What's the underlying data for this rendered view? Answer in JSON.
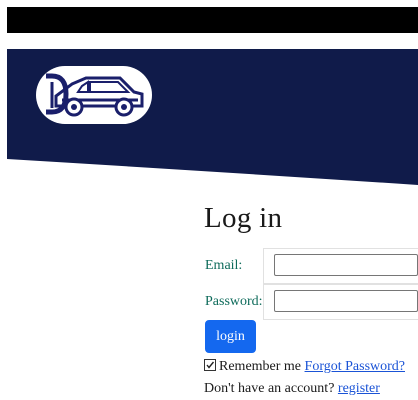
{
  "colors": {
    "hero_background": "#101b4a",
    "label_text": "#0e6b5b",
    "login_button": "#1468ef",
    "link": "#1a53d6"
  },
  "header": {
    "logo_icon": "van-logo-icon"
  },
  "login": {
    "title": "Log in",
    "email_label": "Email:",
    "email_value": "",
    "password_label": "Password:",
    "password_value": "",
    "submit_label": "login",
    "remember_label": "Remember me",
    "remember_checked": true,
    "forgot_link": "Forgot Password?",
    "no_account_text": "Don't have an account?",
    "register_link": "register"
  }
}
